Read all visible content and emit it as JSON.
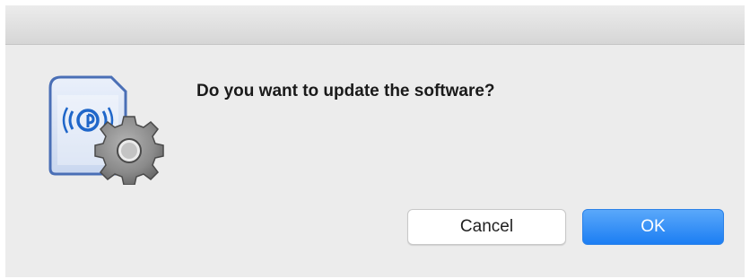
{
  "dialog": {
    "message": "Do you want to update the software?",
    "cancel_label": "Cancel",
    "ok_label": "OK",
    "icon": "sd-card-gear-icon"
  },
  "colors": {
    "window_bg": "#ececec",
    "primary_button": "#1c7ef3",
    "card_border": "#4a6fb6"
  }
}
